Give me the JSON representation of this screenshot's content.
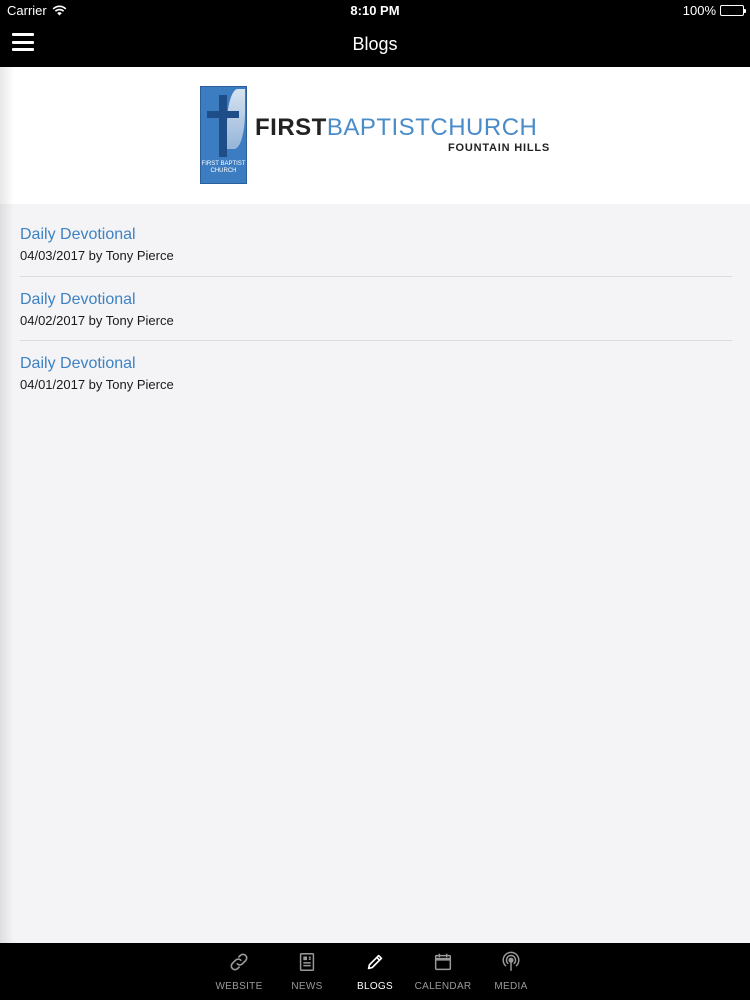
{
  "status": {
    "carrier": "Carrier",
    "time": "8:10 PM",
    "battery": "100%",
    "battery_level": 1.0
  },
  "nav": {
    "title": "Blogs"
  },
  "logo": {
    "name_part1": "FIRST",
    "name_part2": "BAPTIST",
    "name_part3": "CHURCH",
    "subtitle": "FOUNTAIN HILLS",
    "mark_text": "FIRST BAPTIST CHURCH"
  },
  "posts": [
    {
      "title": "Daily Devotional",
      "meta": "04/03/2017 by Tony Pierce"
    },
    {
      "title": "Daily Devotional",
      "meta": "04/02/2017 by Tony Pierce"
    },
    {
      "title": "Daily Devotional",
      "meta": "04/01/2017 by Tony Pierce"
    }
  ],
  "tabs": [
    {
      "label": "WEBSITE",
      "icon": "link-icon"
    },
    {
      "label": "NEWS",
      "icon": "newspaper-icon"
    },
    {
      "label": "BLOGS",
      "icon": "pencil-icon",
      "active": true
    },
    {
      "label": "CALENDAR",
      "icon": "calendar-icon"
    },
    {
      "label": "MEDIA",
      "icon": "podcast-icon"
    }
  ],
  "colors": {
    "link": "#3d82c4",
    "brand_blue": "#4a8bc9",
    "bar": "#000000"
  }
}
